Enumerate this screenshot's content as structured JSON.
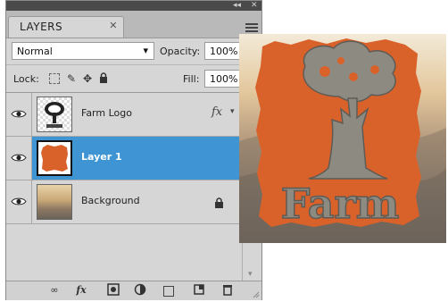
{
  "panel": {
    "dock_controls": [
      "◂◂",
      "✕"
    ],
    "tab_label": "LAYERS",
    "tab_close": "✕"
  },
  "blend": {
    "mode": "Normal",
    "opacity_label": "Opacity:",
    "opacity_value": "100%"
  },
  "lock": {
    "label": "Lock:",
    "fill_label": "Fill:",
    "fill_value": "100%"
  },
  "layers": [
    {
      "name": "Farm Logo",
      "visible": true,
      "selected": false,
      "has_fx": true,
      "fx_label": "fx",
      "locked": false
    },
    {
      "name": "Layer 1",
      "visible": true,
      "selected": true,
      "has_fx": false,
      "locked": false
    },
    {
      "name": "Background",
      "visible": true,
      "selected": false,
      "has_fx": false,
      "locked": true
    }
  ],
  "bottom_icons": [
    "link-layers-icon",
    "add-style-icon",
    "add-mask-icon",
    "adjustment-layer-icon",
    "new-group-icon",
    "new-layer-icon",
    "delete-layer-icon"
  ],
  "bottom_fx_label": "fx",
  "canvas": {
    "text": "Farm",
    "accent_color": "#d9622b",
    "tree_color": "#8d8a82",
    "selection_color": "#3f94d3"
  }
}
